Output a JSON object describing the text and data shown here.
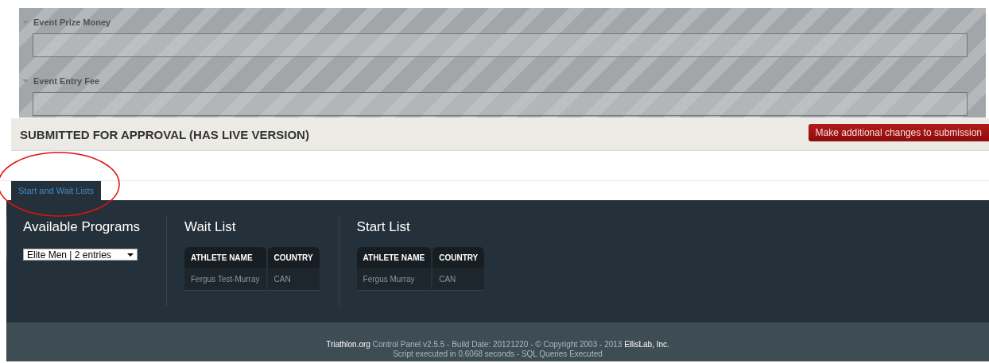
{
  "fields": [
    {
      "label": "Event Prize Money",
      "expanded": true
    },
    {
      "label": "Event Entry Fee",
      "expanded": true
    }
  ],
  "status": {
    "title": "SUBMITTED FOR APPROVAL (HAS LIVE VERSION)",
    "button": "Make additional changes to submission"
  },
  "tabs": [
    {
      "label": "Start and Wait Lists",
      "selected": true
    }
  ],
  "programs": {
    "heading": "Available Programs",
    "select_value": "Elite Men | 2 entries"
  },
  "lists": [
    {
      "heading": "Wait List",
      "columns": [
        "ATHLETE NAME",
        "COUNTRY"
      ],
      "rows": [
        [
          "Fergus Test-Murray",
          "CAN"
        ]
      ]
    },
    {
      "heading": "Start List",
      "columns": [
        "ATHLETE NAME",
        "COUNTRY"
      ],
      "rows": [
        [
          "Fergus Murray",
          "CAN"
        ]
      ]
    }
  ],
  "footer": {
    "brand": "Triathlon.org",
    "text": " Control Panel v2.5.5 - Build Date: 20121220 - © Copyright 2003 - 2013 ",
    "company": "EllisLab, Inc.",
    "line2": "Script executed in 0.6068 seconds - SQL Queries Executed"
  }
}
